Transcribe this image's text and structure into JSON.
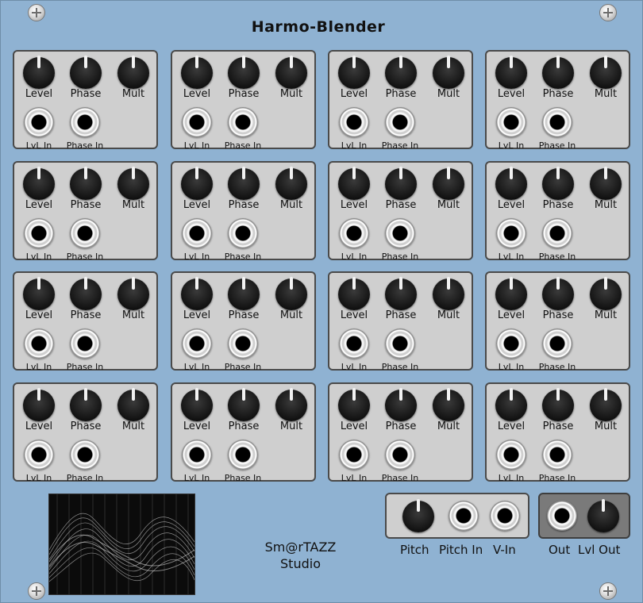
{
  "title": "Harmo-Blender",
  "module_labels": {
    "level": "Level",
    "phase": "Phase",
    "mult": "Mult",
    "lvl_in": "LvL In",
    "phase_in": "Phase In"
  },
  "modules": [
    {
      "index": 1
    },
    {
      "index": 2
    },
    {
      "index": 3
    },
    {
      "index": 4
    },
    {
      "index": 5
    },
    {
      "index": 6
    },
    {
      "index": 7
    },
    {
      "index": 8
    },
    {
      "index": 9
    },
    {
      "index": 10
    },
    {
      "index": 11
    },
    {
      "index": 12
    },
    {
      "index": 13
    },
    {
      "index": 14
    },
    {
      "index": 15
    },
    {
      "index": 16
    }
  ],
  "brand": {
    "line1": "Sm@rTAZZ",
    "line2": "Studio"
  },
  "bottom_controls": {
    "pitch": "Pitch",
    "pitch_in": "Pitch In",
    "v_in": "V-In",
    "out": "Out",
    "lvl_out": "Lvl Out"
  },
  "colors": {
    "panel": "#8fb2d2",
    "module_bg": "#cfcfcf",
    "out_box_bg": "#7a7a7a"
  }
}
